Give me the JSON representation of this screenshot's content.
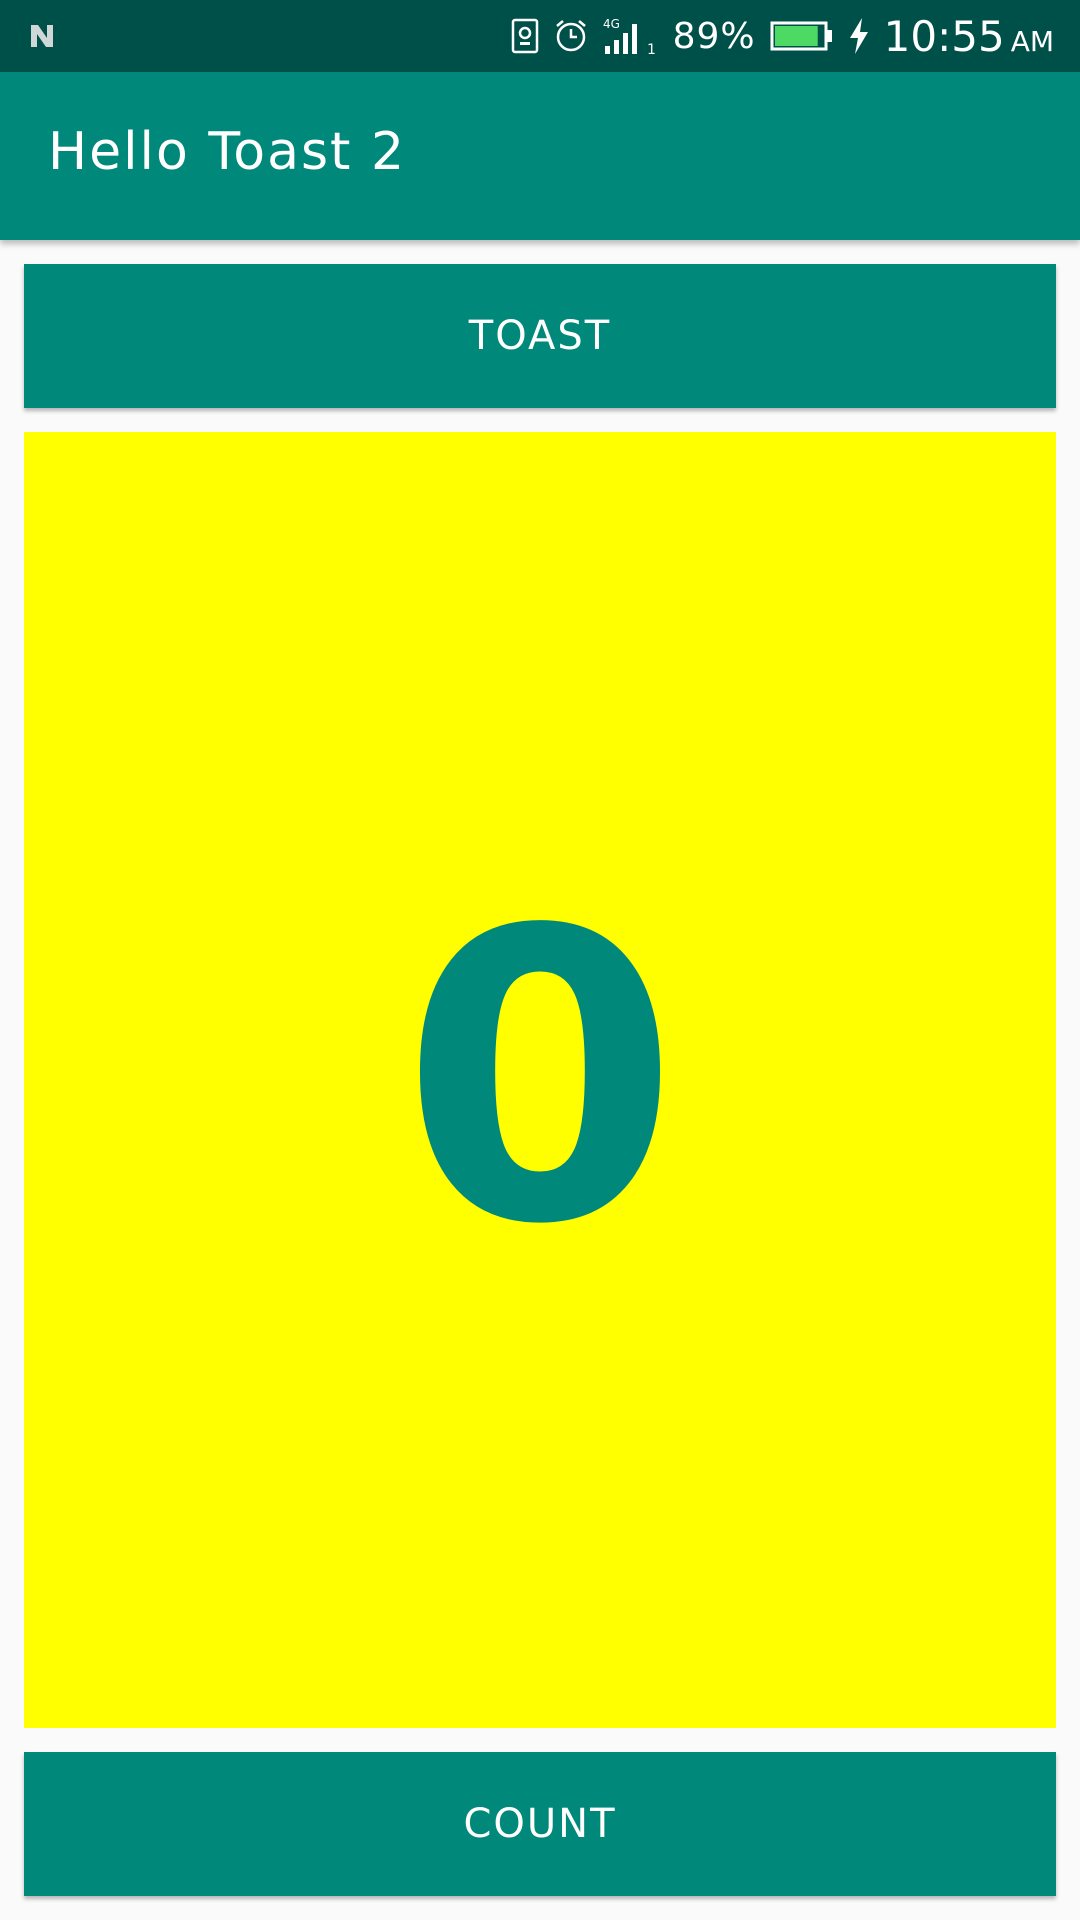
{
  "status_bar": {
    "battery_percent": "89%",
    "time": "10:55",
    "ampm": "AM",
    "network_label": "4G",
    "sim_index": "1",
    "icons": [
      "n-notification-icon",
      "sim-card-icon",
      "alarm-icon",
      "signal-icon",
      "battery-icon",
      "charging-bolt-icon"
    ],
    "battery_level": 0.89,
    "battery_color": "#4cd964"
  },
  "app_bar": {
    "title": "Hello Toast 2",
    "color": "#00897b"
  },
  "buttons": {
    "toast_label": "TOAST",
    "count_label": "COUNT"
  },
  "counter": {
    "value": "0",
    "background": "#ffff00",
    "text_color": "#00897b"
  }
}
